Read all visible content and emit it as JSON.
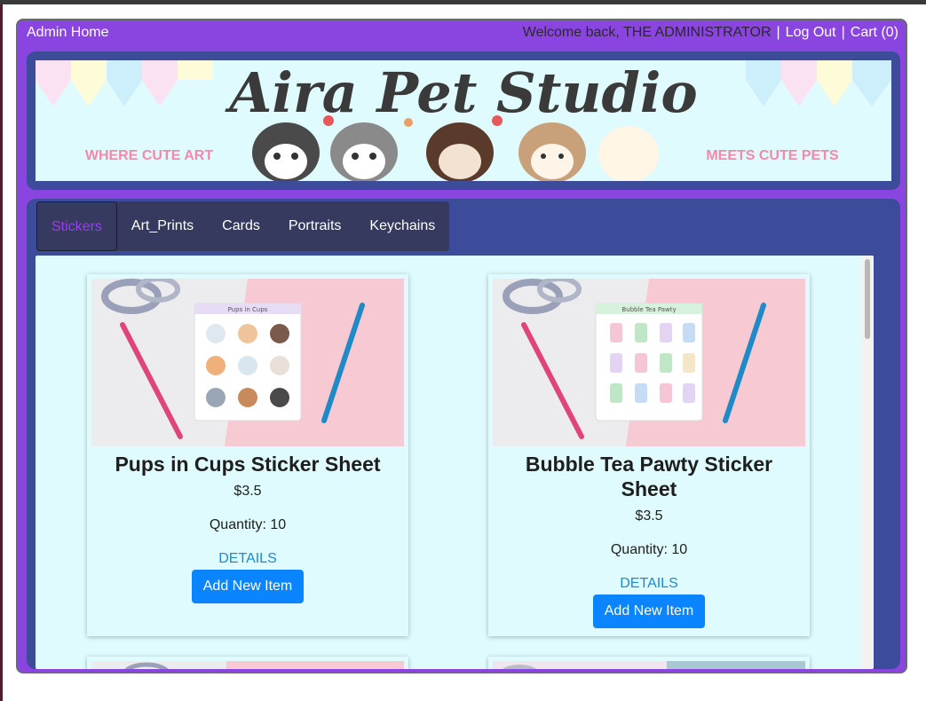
{
  "nav": {
    "admin_home": "Admin Home",
    "welcome": "Welcome back, THE ADMINISTRATOR",
    "separator": "|",
    "logout": "Log Out",
    "cart": "Cart (0)"
  },
  "banner": {
    "title": "Aira Pet Studio",
    "left_tagline": "WHERE CUTE ART",
    "right_tagline": "MEETS CUTE PETS"
  },
  "tabs": [
    {
      "label": "Stickers",
      "active": true
    },
    {
      "label": "Art_Prints",
      "active": false
    },
    {
      "label": "Cards",
      "active": false
    },
    {
      "label": "Portraits",
      "active": false
    },
    {
      "label": "Keychains",
      "active": false
    }
  ],
  "products": [
    {
      "title": "Pups in Cups Sticker Sheet",
      "price": "$3.5",
      "quantity": "Quantity: 10",
      "details": "DETAILS",
      "button": "Add New Item",
      "sheet_header": "Pups in Cups"
    },
    {
      "title": "Bubble Tea Pawty Sticker Sheet",
      "price": "$3.5",
      "quantity": "Quantity: 10",
      "details": "DETAILS",
      "button": "Add New Item",
      "sheet_header": "Bubble Tea Pawty"
    }
  ],
  "colors": {
    "app_bg": "#8a45e0",
    "panel_frame": "#3d4c9a",
    "panel_bg": "#dffbfd",
    "tab_bar": "#353a5e",
    "active_tab_text": "#9a3cf2",
    "button": "#0a84ff",
    "link": "#1a8ad6"
  }
}
